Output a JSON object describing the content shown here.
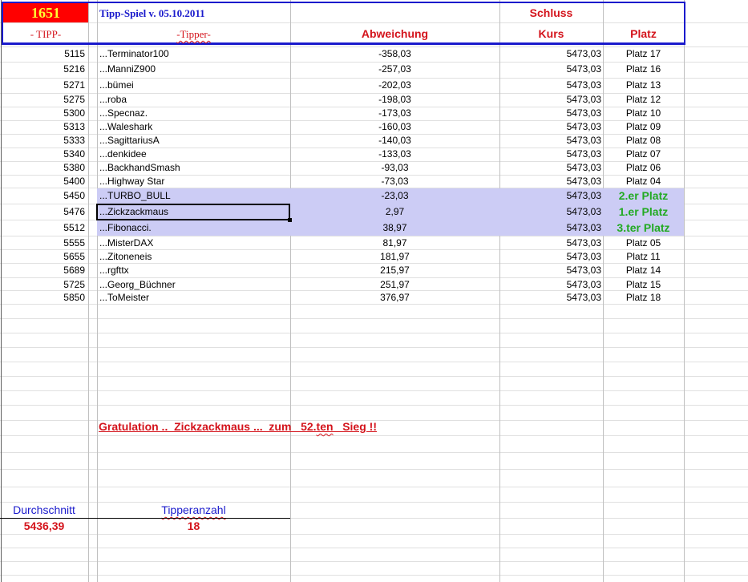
{
  "header": {
    "count": "1651",
    "title": "Tipp-Spiel v. 05.10.2011",
    "col_tipp": "- TIPP-",
    "col_tipper": "-Tipper-",
    "col_abweichung": "Abweichung",
    "col_kurs_top": "Schluss",
    "col_kurs": "Kurs",
    "col_platz": "Platz"
  },
  "colors": {
    "accent_blue": "#1a1acc",
    "red": "#d4141c",
    "yellow": "#ffff33",
    "green": "#22aa22",
    "highlight": "#ccccf5"
  },
  "rows": [
    {
      "tipp": "5115",
      "tipper": "...Terminator100",
      "abw": "-358,03",
      "kurs": "5473,03",
      "platz": "Platz 17"
    },
    {
      "tipp": "5216",
      "tipper": "...ManniZ900",
      "abw": "-257,03",
      "kurs": "5473,03",
      "platz": "Platz 16"
    },
    {
      "tipp": "5271",
      "tipper": "...bümei",
      "abw": "-202,03",
      "kurs": "5473,03",
      "platz": "Platz 13"
    },
    {
      "tipp": "5275",
      "tipper": "...roba",
      "abw": "-198,03",
      "kurs": "5473,03",
      "platz": "Platz 12"
    },
    {
      "tipp": "5300",
      "tipper": "...Specnaz.",
      "abw": "-173,03",
      "kurs": "5473,03",
      "platz": "Platz 10"
    },
    {
      "tipp": "5313",
      "tipper": "...Waleshark",
      "abw": "-160,03",
      "kurs": "5473,03",
      "platz": "Platz 09"
    },
    {
      "tipp": "5333",
      "tipper": "...SagittariusA",
      "abw": "-140,03",
      "kurs": "5473,03",
      "platz": "Platz 08"
    },
    {
      "tipp": "5340",
      "tipper": "...denkidee",
      "abw": "-133,03",
      "kurs": "5473,03",
      "platz": "Platz 07"
    },
    {
      "tipp": "5380",
      "tipper": "...BackhandSmash",
      "abw": "-93,03",
      "kurs": "5473,03",
      "platz": "Platz 06"
    },
    {
      "tipp": "5400",
      "tipper": "...Highway Star",
      "abw": "-73,03",
      "kurs": "5473,03",
      "platz": "Platz 04"
    },
    {
      "tipp": "5450",
      "tipper": "...TURBO_BULL",
      "abw": "-23,03",
      "kurs": "5473,03",
      "platz": "2.er Platz",
      "winner": true
    },
    {
      "tipp": "5476",
      "tipper": "...Zickzackmaus",
      "abw": "2,97",
      "kurs": "5473,03",
      "platz": "1.er Platz",
      "winner": true,
      "selected": true
    },
    {
      "tipp": "5512",
      "tipper": "...Fibonacci.",
      "abw": "38,97",
      "kurs": "5473,03",
      "platz": "3.ter Platz",
      "winner": true
    },
    {
      "tipp": "5555",
      "tipper": "...MisterDAX",
      "abw": "81,97",
      "kurs": "5473,03",
      "platz": "Platz 05"
    },
    {
      "tipp": "5655",
      "tipper": "...Zitoneneis",
      "abw": "181,97",
      "kurs": "5473,03",
      "platz": "Platz 11"
    },
    {
      "tipp": "5689",
      "tipper": "...rgfttx",
      "abw": "215,97",
      "kurs": "5473,03",
      "platz": "Platz 14"
    },
    {
      "tipp": "5725",
      "tipper": "...Georg_Büchner",
      "abw": "251,97",
      "kurs": "5473,03",
      "platz": "Platz 15"
    },
    {
      "tipp": "5850",
      "tipper": "...ToMeister",
      "abw": "376,97",
      "kurs": "5473,03",
      "platz": "Platz 18"
    }
  ],
  "congrats": {
    "pre": "Gratulation ..  Zickzackmaus ...  zum   52.",
    "wavy": "ten",
    "post": "   Sieg !!"
  },
  "summary": {
    "avg_label": "Durchschnitt",
    "avg_value": "5436,39",
    "count_label": "Tipperanzahl",
    "count_value": "18"
  }
}
